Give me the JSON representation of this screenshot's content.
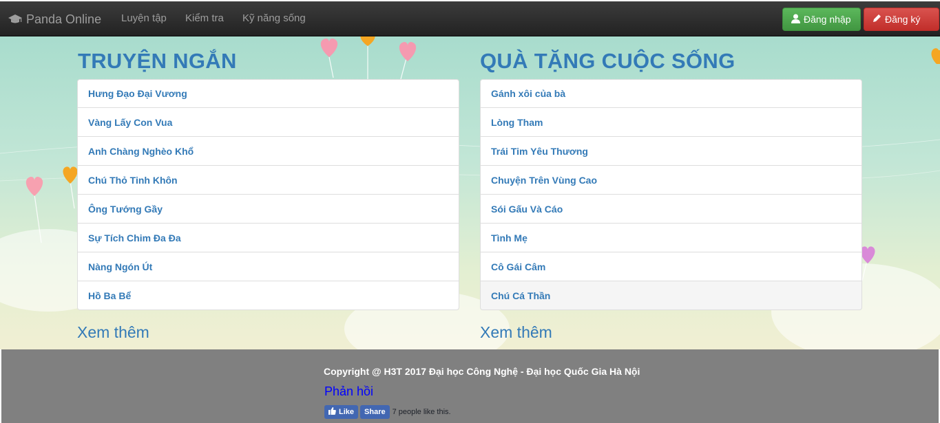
{
  "navbar": {
    "brand": "Panda Online",
    "links": [
      "Luyện tập",
      "Kiểm tra",
      "Kỹ năng sống"
    ],
    "login": "Đăng nhập",
    "register": "Đăng ký"
  },
  "left": {
    "title": "TRUYỆN NGẮN",
    "items": [
      "Hưng Đạo Đại Vương",
      "Vàng Lấy Con Vua",
      "Anh Chàng Nghèo Khổ",
      "Chú Thỏ Tinh Khôn",
      "Ông Tướng Gầy",
      "Sự Tích Chim Đa Đa",
      "Nàng Ngón Út",
      "Hồ Ba Bể"
    ],
    "more": "Xem thêm"
  },
  "right": {
    "title": "QUÀ TẶNG CUỘC SỐNG",
    "items": [
      "Gánh xôi của bà",
      "Lòng Tham",
      "Trái Tim Yêu Thương",
      "Chuyện Trên Vùng Cao",
      "Sói Gấu Và Cáo",
      "Tình Mẹ",
      "Cô Gái Câm",
      "Chú Cá Thần"
    ],
    "more": "Xem thêm"
  },
  "footer": {
    "copyright": "Copyright @ H3T 2017 Đại học Công Nghệ - Đại học Quốc Gia Hà Nội",
    "feedback": "Phản hồi",
    "like": "Like",
    "share": "Share",
    "like_count": "7 people like this."
  },
  "colors": {
    "accent": "#337ab7",
    "login_green": "#5cb85c",
    "register_red": "#d9534f",
    "footer_gray": "#808080"
  },
  "icons": {
    "brand": "graduation-cap-icon",
    "login": "user-icon",
    "register": "pencil-icon",
    "like": "thumbs-up-icon"
  }
}
